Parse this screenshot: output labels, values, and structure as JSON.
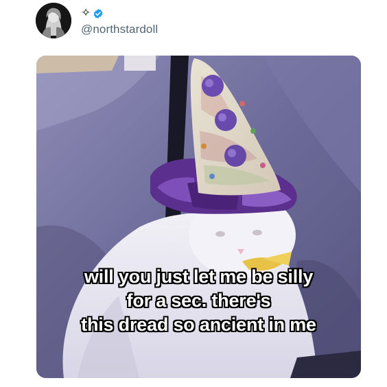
{
  "post": {
    "display_name_icon": "sparkle-icon",
    "verified_icon": "verified-badge-icon",
    "handle": "@northstardoll",
    "accent_color": "#1d9bf0"
  },
  "media": {
    "caption_lines": [
      "will you just let me be silly",
      "for a sec. there's",
      "this dread so ancient in me"
    ]
  }
}
